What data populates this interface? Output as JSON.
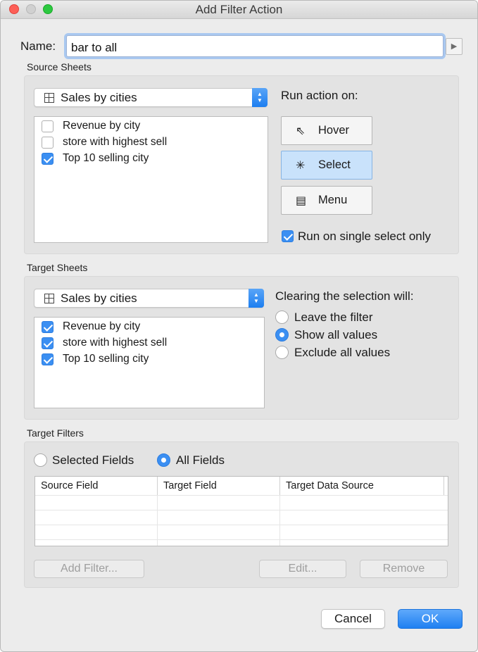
{
  "window": {
    "title": "Add Filter Action"
  },
  "name": {
    "label": "Name:",
    "value": "bar to all",
    "arrow": "▶"
  },
  "source": {
    "section_title": "Source Sheets",
    "dropdown_value": "Sales by cities",
    "sheets": [
      {
        "label": "Revenue by city",
        "checked": false
      },
      {
        "label": "store with highest sell",
        "checked": false
      },
      {
        "label": "Top 10 selling city",
        "checked": true
      }
    ],
    "run_action_label": "Run action on:",
    "buttons": {
      "hover": "Hover",
      "select": "Select",
      "menu": "Menu"
    },
    "active_button": "select",
    "single_select_label": "Run on single select only",
    "single_select_checked": true
  },
  "target": {
    "section_title": "Target Sheets",
    "dropdown_value": "Sales by cities",
    "sheets": [
      {
        "label": "Revenue by city",
        "checked": true
      },
      {
        "label": "store with highest sell",
        "checked": true
      },
      {
        "label": "Top 10 selling city",
        "checked": true
      }
    ],
    "clearing_label": "Clearing the selection will:",
    "options": {
      "leave": "Leave the filter",
      "show": "Show all values",
      "exclude": "Exclude all values"
    },
    "selected_option": "show"
  },
  "filters": {
    "section_title": "Target Filters",
    "selected_fields_label": "Selected Fields",
    "all_fields_label": "All Fields",
    "selected_mode": "all",
    "columns": [
      "Source Field",
      "Target Field",
      "Target Data Source"
    ],
    "add_label": "Add Filter...",
    "edit_label": "Edit...",
    "remove_label": "Remove"
  },
  "footer": {
    "cancel_label": "Cancel",
    "ok_label": "OK"
  },
  "colors": {
    "accent": "#3b8ff2",
    "active_button_bg": "#c9e2fb"
  }
}
